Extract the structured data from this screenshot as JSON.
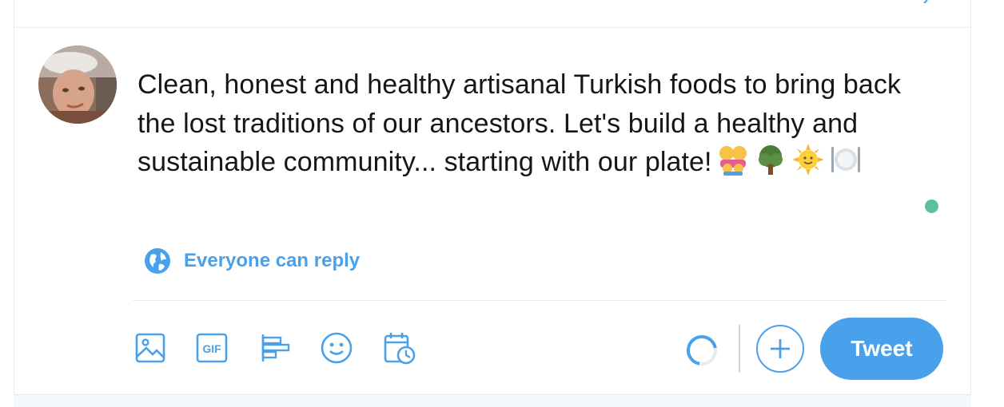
{
  "compose": {
    "text": "Clean, honest and healthy artisanal Turkish foods to bring back the lost traditions of our ancestors. Let's build a healthy and sustainable community... starting with our plate!",
    "emojis": [
      "family-emoji",
      "tree-emoji",
      "sun-emoji",
      "plate-cutlery-emoji"
    ],
    "reply_setting": "Everyone can reply",
    "tweet_button": "Tweet"
  },
  "toolbar": {
    "icons": [
      "image-icon",
      "gif-icon",
      "poll-icon",
      "emoji-icon",
      "schedule-icon"
    ],
    "gif_glyph": "GIF"
  },
  "colors": {
    "accent": "#4aa1eb",
    "text": "#14171a",
    "border": "#e6ecf0",
    "status_dot": "#5cc19a"
  }
}
